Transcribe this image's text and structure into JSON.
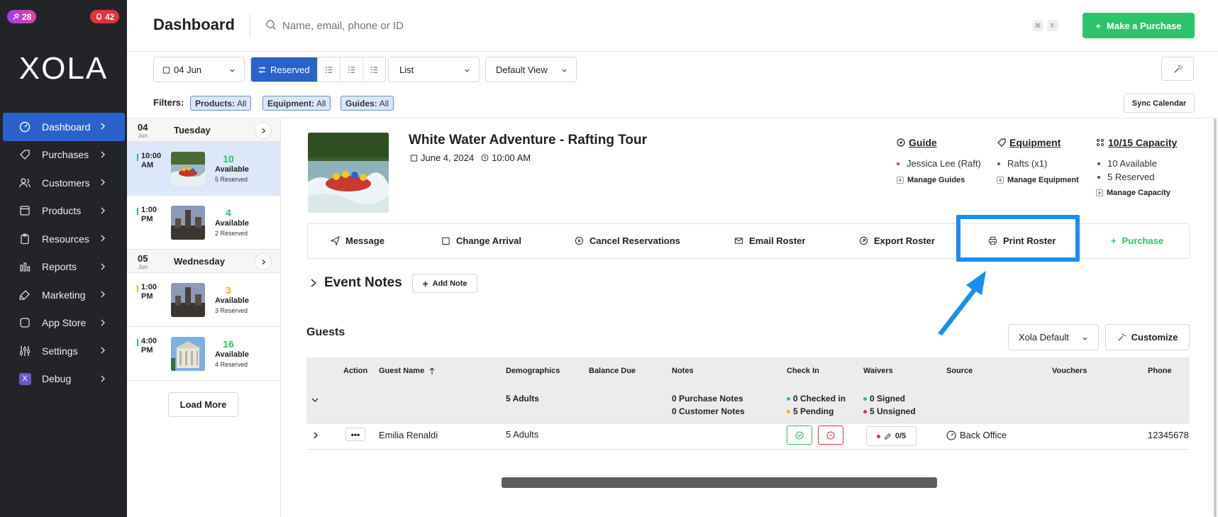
{
  "sidebar": {
    "badge_promo": "28",
    "badge_alerts": "42",
    "logo": "XOLA",
    "items": [
      {
        "label": "Dashboard"
      },
      {
        "label": "Purchases"
      },
      {
        "label": "Customers"
      },
      {
        "label": "Products"
      },
      {
        "label": "Resources"
      },
      {
        "label": "Reports"
      },
      {
        "label": "Marketing"
      },
      {
        "label": "App Store"
      },
      {
        "label": "Settings"
      },
      {
        "label": "Debug"
      }
    ]
  },
  "header": {
    "title": "Dashboard",
    "search_placeholder": "Name, email, phone or ID",
    "kbd_cmd": "⌘",
    "kbd_k": "K",
    "purchase_button": "Make a Purchase"
  },
  "toolbar": {
    "date": "04 Jun",
    "view_reserved": "Reserved",
    "layout": "List",
    "view_preset": "Default View"
  },
  "filters": {
    "label": "Filters:",
    "chips": [
      {
        "key": "Products:",
        "value": "All"
      },
      {
        "key": "Equipment:",
        "value": "All"
      },
      {
        "key": "Guides:",
        "value": "All"
      }
    ],
    "sync_calendar": "Sync Calendar"
  },
  "events_list": {
    "days": [
      {
        "num": "04",
        "month": "Jun",
        "name": "Tuesday",
        "slots": [
          {
            "time1": "10:00",
            "time2": "AM",
            "count": "10",
            "available": "Available",
            "reserved": "5 Reserved",
            "color": "#2cc36b"
          },
          {
            "time1": "1:00",
            "time2": "PM",
            "count": "4",
            "available": "Available",
            "reserved": "2 Reserved",
            "color": "#2cc36b"
          }
        ]
      },
      {
        "num": "05",
        "month": "Jun",
        "name": "Wednesday",
        "slots": [
          {
            "time1": "1:00",
            "time2": "PM",
            "count": "3",
            "available": "Available",
            "reserved": "3 Reserved",
            "color": "#f5b400"
          },
          {
            "time1": "4:00",
            "time2": "PM",
            "count": "16",
            "available": "Available",
            "reserved": "4 Reserved",
            "color": "#2cc36b"
          }
        ]
      }
    ],
    "load_more": "Load More"
  },
  "event": {
    "title": "White Water Adventure - Rafting Tour",
    "date": "June 4, 2024",
    "time": "10:00 AM",
    "guide": {
      "heading": "Guide",
      "item": "Jessica Lee (Raft)",
      "manage": "Manage Guides"
    },
    "equipment": {
      "heading": "Equipment",
      "item": "Rafts (x1)",
      "manage": "Manage Equipment"
    },
    "capacity": {
      "heading": "10/15 Capacity",
      "item1": "10 Available",
      "item2": "5 Reserved",
      "manage": "Manage Capacity"
    }
  },
  "actions": {
    "message": "Message",
    "change_arrival": "Change Arrival",
    "cancel": "Cancel Reservations",
    "email_roster": "Email Roster",
    "export_roster": "Export Roster",
    "print_roster": "Print Roster",
    "purchase": "Purchase"
  },
  "notes": {
    "title": "Event Notes",
    "add": "Add Note"
  },
  "guests": {
    "title": "Guests",
    "preset": "Xola Default",
    "customize": "Customize",
    "columns": [
      "Action",
      "Guest Name",
      "Demographics",
      "Balance Due",
      "Notes",
      "Check In",
      "Waivers",
      "Source",
      "Vouchers",
      "Phone"
    ],
    "summary": {
      "demographics": "5 Adults",
      "purchase_notes": "0 Purchase Notes",
      "customer_notes": "0 Customer Notes",
      "checked_in": "0 Checked in",
      "pending": "5 Pending",
      "signed": "0 Signed",
      "unsigned": "5 Unsigned"
    },
    "rows": [
      {
        "name": "Emilia Renaldi",
        "demographics": "5 Adults",
        "waivers": "0/5",
        "source": "Back Office",
        "phone": "12345678",
        "more": "•••"
      }
    ]
  },
  "colors": {
    "sidebar_bg": "#222427",
    "accent_blue": "#2a62c9",
    "brand_green": "#2cc36b",
    "danger_red": "#e1343c",
    "highlight_blue": "#1b8ef0"
  }
}
